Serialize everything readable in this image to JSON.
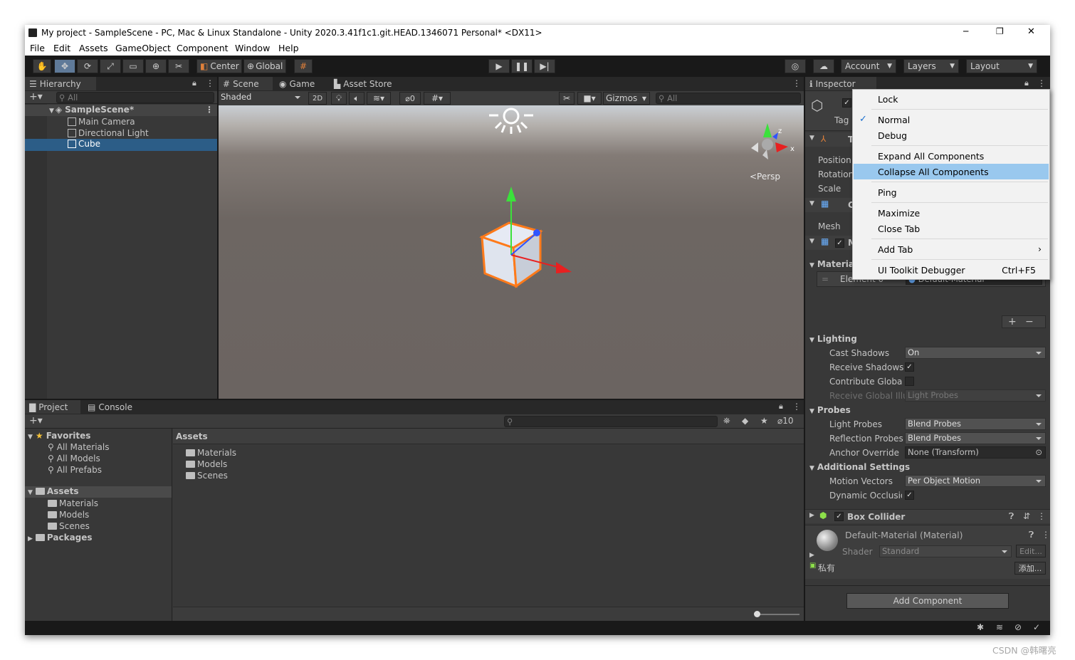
{
  "window": {
    "title": "My project - SampleScene - PC, Mac & Linux Standalone - Unity 2020.3.41f1c1.git.HEAD.1346071 Personal* <DX11>",
    "controls": {
      "minimize": "─",
      "maximize": "❐",
      "close": "✕"
    }
  },
  "menubar": [
    "File",
    "Edit",
    "Assets",
    "GameObject",
    "Component",
    "Window",
    "Help"
  ],
  "toolbar": {
    "pivot": "Center",
    "space": "Global",
    "account": "Account",
    "layers": "Layers",
    "layout": "Layout"
  },
  "hierarchy": {
    "tab": "Hierarchy",
    "search_placeholder": "All",
    "scene": "SampleScene*",
    "items": [
      "Main Camera",
      "Directional Light",
      "Cube"
    ],
    "selected": "Cube"
  },
  "scene_view": {
    "tabs": [
      "Scene",
      "Game",
      "Asset Store"
    ],
    "shading": "Shaded",
    "mode_2d": "2D",
    "hidden_count": "0",
    "gizmos": "Gizmos",
    "search_placeholder": "All",
    "persp_label": "<Persp",
    "axis_x": "x",
    "axis_z": "z"
  },
  "project": {
    "tabs": [
      "Project",
      "Console"
    ],
    "hidden_count": "10",
    "favorites_label": "Favorites",
    "favorites": [
      "All Materials",
      "All Models",
      "All Prefabs"
    ],
    "assets_label": "Assets",
    "asset_folders": [
      "Materials",
      "Models",
      "Scenes"
    ],
    "packages_label": "Packages",
    "breadcrumb": "Assets",
    "grid_items": [
      "Materials",
      "Models",
      "Scenes"
    ]
  },
  "inspector": {
    "tab": "Inspector",
    "tag_label": "Tag",
    "transform": {
      "header": "T",
      "position": "Position",
      "rotation": "Rotation",
      "scale": "Scale"
    },
    "mesh_filter": {
      "header": "C",
      "mesh": "Mesh"
    },
    "mesh_renderer_header": "M",
    "materials_label": "Materia",
    "element0": "Element 0",
    "element0_value": "Default-Material",
    "lighting": {
      "label": "Lighting",
      "cast_shadows": "Cast Shadows",
      "cast_shadows_value": "On",
      "receive_shadows": "Receive Shadows",
      "contribute_gi": "Contribute Global I",
      "receive_gi": "Receive Global Illu",
      "receive_gi_value": "Light Probes"
    },
    "probes": {
      "label": "Probes",
      "light_probes": "Light Probes",
      "light_probes_value": "Blend Probes",
      "reflection_probes": "Reflection Probes",
      "reflection_probes_value": "Blend Probes",
      "anchor_override": "Anchor Override",
      "anchor_override_value": "None (Transform)"
    },
    "additional": {
      "label": "Additional Settings",
      "motion_vectors": "Motion Vectors",
      "motion_vectors_value": "Per Object Motion",
      "dynamic_occlusion": "Dynamic Occlusio"
    },
    "box_collider": "Box Collider",
    "material": {
      "name": "Default-Material (Material)",
      "shader_label": "Shader",
      "shader_value": "Standard",
      "edit": "Edit...",
      "private_label": "私有",
      "add_button": "添加..."
    },
    "add_component": "Add Component"
  },
  "context_menu": {
    "items": [
      {
        "label": "Lock",
        "checked": false
      },
      {
        "label": "Normal",
        "checked": true
      },
      {
        "label": "Debug",
        "checked": false
      },
      {
        "label": "Expand All Components",
        "checked": false
      },
      {
        "label": "Collapse All Components",
        "checked": false,
        "highlighted": true
      },
      {
        "label": "Ping",
        "checked": false
      },
      {
        "label": "Maximize",
        "checked": false
      },
      {
        "label": "Close Tab",
        "checked": false
      },
      {
        "label": "Add Tab",
        "submenu": true
      },
      {
        "label": "UI Toolkit Debugger",
        "shortcut": "Ctrl+F5"
      }
    ]
  },
  "colors": {
    "highlight": "#99c8ee",
    "selection": "#2c5d87",
    "editor_bg": "#383838"
  },
  "watermark": "CSDN @韩曙亮"
}
